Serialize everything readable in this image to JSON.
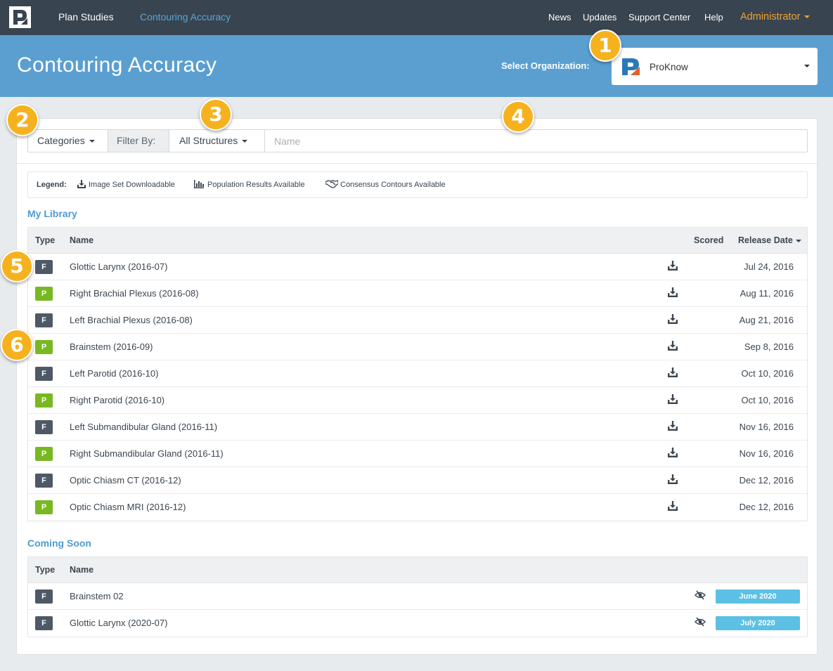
{
  "nav": {
    "items": [
      "Plan Studies",
      "Contouring Accuracy"
    ],
    "right_items": [
      "News",
      "Updates",
      "Support Center",
      "Help"
    ],
    "user": "Administrator"
  },
  "banner": {
    "title": "Contouring Accuracy",
    "org_label": "Select Organization:",
    "org_value": "ProKnow"
  },
  "filters": {
    "categories": "Categories",
    "filter_by": "Filter By:",
    "structures": "All Structures",
    "name_placeholder": "Name"
  },
  "legend": {
    "title": "Legend:",
    "items": [
      "Image Set Downloadable",
      "Population Results Available",
      "Consensus Contours Available"
    ]
  },
  "library": {
    "title": "My Library",
    "columns": [
      "Type",
      "Name",
      "Scored",
      "Release Date"
    ],
    "rows": [
      {
        "type": "F",
        "name": "Glottic Larynx (2016-07)",
        "date": "Jul 24, 2016"
      },
      {
        "type": "P",
        "name": "Right Brachial Plexus (2016-08)",
        "date": "Aug 11, 2016"
      },
      {
        "type": "F",
        "name": "Left Brachial Plexus (2016-08)",
        "date": "Aug 21, 2016"
      },
      {
        "type": "P",
        "name": "Brainstem (2016-09)",
        "date": "Sep 8, 2016"
      },
      {
        "type": "F",
        "name": "Left Parotid (2016-10)",
        "date": "Oct 10, 2016"
      },
      {
        "type": "P",
        "name": "Right Parotid (2016-10)",
        "date": "Oct 10, 2016"
      },
      {
        "type": "F",
        "name": "Left Submandibular Gland (2016-11)",
        "date": "Nov 16, 2016"
      },
      {
        "type": "P",
        "name": "Right Submandibular Gland (2016-11)",
        "date": "Nov 16, 2016"
      },
      {
        "type": "F",
        "name": "Optic Chiasm CT (2016-12)",
        "date": "Dec 12, 2016"
      },
      {
        "type": "P",
        "name": "Optic Chiasm MRI (2016-12)",
        "date": "Dec 12, 2016"
      }
    ]
  },
  "coming_soon": {
    "title": "Coming Soon",
    "columns": [
      "Type",
      "Name"
    ],
    "rows": [
      {
        "type": "F",
        "name": "Brainstem 02",
        "release": "June 2020"
      },
      {
        "type": "F",
        "name": "Glottic Larynx (2020-07)",
        "release": "July 2020"
      }
    ]
  },
  "callouts": [
    "1",
    "2",
    "3",
    "4",
    "5",
    "6"
  ],
  "colors": {
    "nav_bg": "#38444f",
    "banner_bg": "#5b9fd1",
    "accent_link": "#5aa6d6",
    "admin": "#f0a333",
    "badge_F": "#4d5966",
    "badge_P": "#78b821",
    "coming_soon_badge": "#5bc0e4",
    "callout": "#f6b21e"
  }
}
